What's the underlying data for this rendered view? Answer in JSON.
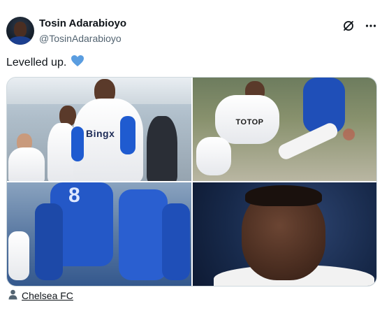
{
  "author": {
    "display_name": "Tosin Adarabioyo",
    "handle": "@TosinAdarabioyo"
  },
  "tweet": {
    "text": "Levelled up.",
    "emoji": "💙"
  },
  "media": {
    "photos": [
      {
        "sponsor": "Bingx"
      },
      {
        "sponsor": "TOTOP"
      },
      {
        "number": "8"
      },
      {}
    ]
  },
  "place": {
    "label": "Chelsea FC"
  },
  "icons": {
    "grok": "grok-icon",
    "more": "more-icon",
    "place": "person-icon"
  },
  "colors": {
    "heart": "#5a9de0",
    "handle": "#536471",
    "border": "#cfd9de"
  }
}
